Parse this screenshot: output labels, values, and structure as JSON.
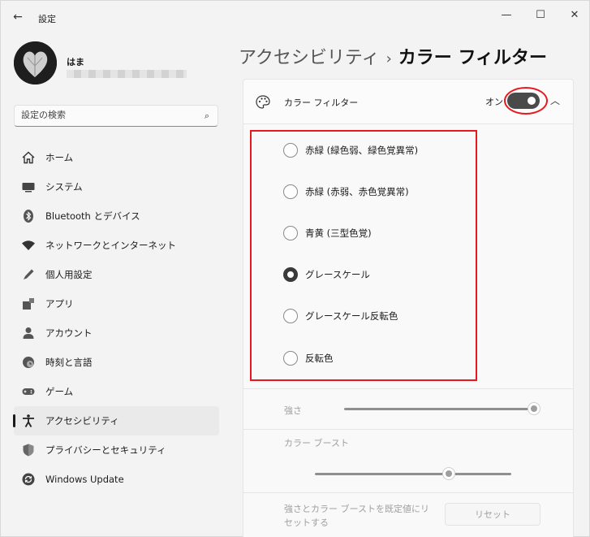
{
  "window": {
    "title": "設定",
    "minimize": "—",
    "maximize": "☐",
    "close": "✕",
    "back": "←"
  },
  "profile": {
    "name": "はま"
  },
  "search": {
    "placeholder": "設定の検索",
    "icon": "⌕"
  },
  "sidebar": {
    "items": [
      {
        "label": "ホーム",
        "icon": "home-icon"
      },
      {
        "label": "システム",
        "icon": "system-icon"
      },
      {
        "label": "Bluetooth とデバイス",
        "icon": "bluetooth-icon"
      },
      {
        "label": "ネットワークとインターネット",
        "icon": "wifi-icon"
      },
      {
        "label": "個人用設定",
        "icon": "pen-icon"
      },
      {
        "label": "アプリ",
        "icon": "apps-icon"
      },
      {
        "label": "アカウント",
        "icon": "account-icon"
      },
      {
        "label": "時刻と言語",
        "icon": "clock-globe-icon"
      },
      {
        "label": "ゲーム",
        "icon": "gamepad-icon"
      },
      {
        "label": "アクセシビリティ",
        "icon": "accessibility-icon",
        "active": true
      },
      {
        "label": "プライバシーとセキュリティ",
        "icon": "shield-icon"
      },
      {
        "label": "Windows Update",
        "icon": "update-icon"
      }
    ]
  },
  "breadcrumb": {
    "parent": "アクセシビリティ",
    "separator": "›",
    "current": "カラー フィルター"
  },
  "color_filter": {
    "label": "カラー フィルター",
    "toggle_state": "オン",
    "toggle_on": true,
    "chevron": "︿",
    "options": [
      {
        "label": "赤緑 (緑色弱、緑色覚異常)",
        "checked": false
      },
      {
        "label": "赤緑 (赤弱、赤色覚異常)",
        "checked": false
      },
      {
        "label": "青黄 (三型色覚)",
        "checked": false
      },
      {
        "label": "グレースケール",
        "checked": true
      },
      {
        "label": "グレースケール反転色",
        "checked": false
      },
      {
        "label": "反転色",
        "checked": false
      }
    ]
  },
  "intensity": {
    "label": "強さ",
    "value_fraction": 1.0
  },
  "color_boost": {
    "label": "カラー ブースト",
    "value_fraction": 0.68
  },
  "reset": {
    "description_line1": "強さとカラー ブーストを既定値にリ",
    "description_line2": "セットする",
    "button_label": "リセット"
  },
  "colors": {
    "accent": "#3a3a3a",
    "highlight": "#e8181e",
    "background": "#f3f3f3"
  }
}
